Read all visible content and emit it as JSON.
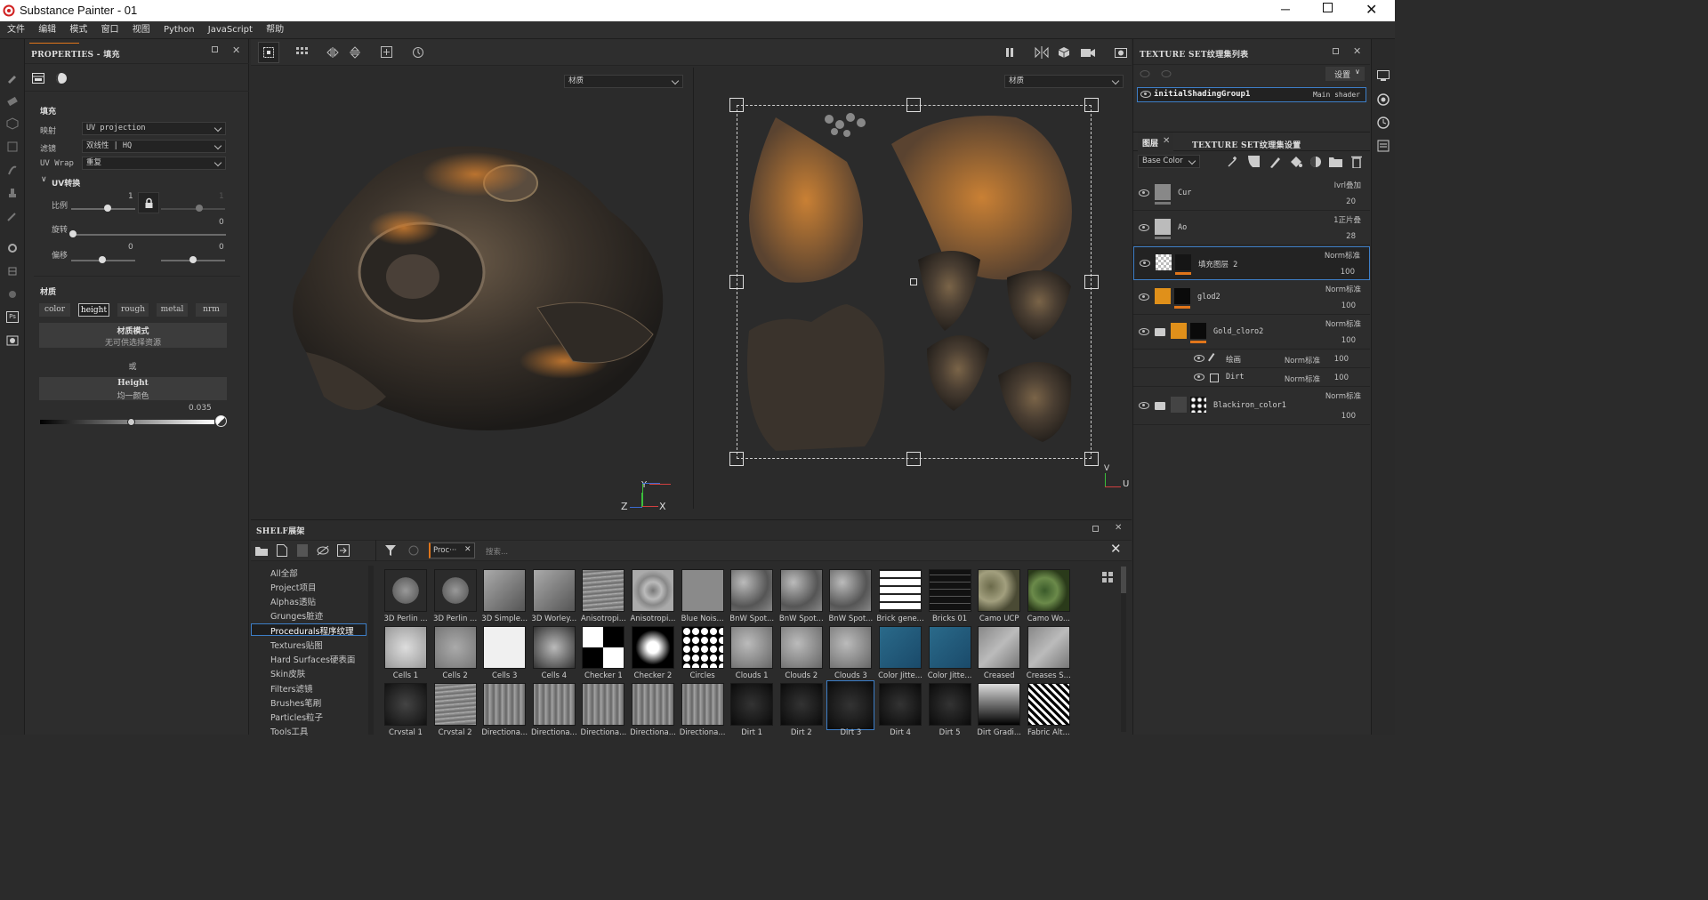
{
  "window": {
    "title": "Substance Painter - 01"
  },
  "menubar": [
    "文件",
    "编辑",
    "模式",
    "窗口",
    "视图",
    "Python",
    "JavaScript",
    "帮助"
  ],
  "properties": {
    "title": "PROPERTIES - 填充",
    "section_fill": "填充",
    "projection_label": "映射",
    "projection_value": "UV projection",
    "filter_label": "滤镜",
    "filter_value": "双线性 | HQ",
    "uvwrap_label": "UV Wrap",
    "uvwrap_value": "重复",
    "uv_transform_label": "UV转换",
    "scale_label": "比例",
    "scale_value": "1",
    "scale_value2": "1",
    "rotate_label": "旋转",
    "rotate_value": "0",
    "offset_label": "偏移",
    "offset_value1": "0",
    "offset_value2": "0",
    "material_label": "材质",
    "channels": [
      "color",
      "height",
      "rough",
      "metal",
      "nrm"
    ],
    "selected_channel": "height",
    "mat_mode_title": "材质模式",
    "mat_mode_sub": "无可供选择资源",
    "or_label": "或",
    "height_title": "Height",
    "height_sub": "均一颜色",
    "height_value": "0.035",
    "height_fraction": 0.52
  },
  "viewport": {
    "left_dropdown": "材质",
    "right_dropdown": "材质",
    "axis_left": {
      "z": "Z",
      "y": "Y",
      "x": "X"
    },
    "axis_right": {
      "v": "V",
      "u": "U"
    }
  },
  "shelf": {
    "title": "SHELF展架",
    "filter_tag": "Proc···",
    "search_placeholder": "搜索...",
    "categories": [
      "All全部",
      "Project项目",
      "Alphas透贴",
      "Grunges脏迹",
      "Procedurals程序纹理",
      "Textures贴图",
      "Hard Surfaces硬表面",
      "Skin皮肤",
      "Filters滤镜",
      "Brushes笔刷",
      "Particles粒子",
      "Tools工具"
    ],
    "selected_category": "Procedurals程序纹理",
    "row1": [
      "3D Perlin ...",
      "3D Perlin ...",
      "3D Simple...",
      "3D Worley...",
      "Anisotropi...",
      "Anisotropi...",
      "Blue Nois...",
      "BnW Spot...",
      "BnW Spot...",
      "BnW Spot...",
      "Brick gene...",
      "Bricks 01",
      "Camo UCP",
      "Camo Wo..."
    ],
    "row2": [
      "Cells 1",
      "Cells 2",
      "Cells 3",
      "Cells 4",
      "Checker 1",
      "Checker 2",
      "Circles",
      "Clouds 1",
      "Clouds 2",
      "Clouds 3",
      "Color Jitte...",
      "Color Jitte...",
      "Creased",
      "Creases S..."
    ],
    "row3": [
      "Crystal 1",
      "Crystal 2",
      "Directiona...",
      "Directiona...",
      "Directiona...",
      "Directiona...",
      "Directiona...",
      "Dirt 1",
      "Dirt 2",
      "Dirt 3",
      "Dirt 4",
      "Dirt 5",
      "Dirt Gradi...",
      "Fabric Alt..."
    ]
  },
  "texture_sets": {
    "title": "TEXTURE SET纹理集列表",
    "settings_btn": "设置",
    "set_name": "initialShadingGroup1",
    "set_shader": "Main shader"
  },
  "layers": {
    "tab_layers": "图层",
    "tab_settings": "TEXTURE SET纹理集设置",
    "channel_dropdown": "Base Color",
    "items": [
      {
        "name": "Cur",
        "blend": "Ivrl叠加",
        "opacity": "20"
      },
      {
        "name": "Ao",
        "blend": "1正片叠",
        "opacity": "28"
      },
      {
        "name": "填充图层 2",
        "blend": "Norm标准",
        "opacity": "100"
      },
      {
        "name": "glod2",
        "blend": "Norm标准",
        "opacity": "100"
      },
      {
        "name": "Gold_cloro2",
        "blend": "Norm标准",
        "opacity": "100"
      },
      {
        "name": "绘画",
        "blend": "Norm标准",
        "opacity": "100"
      },
      {
        "name": "Dirt",
        "blend": "Norm标准",
        "opacity": "100"
      },
      {
        "name": "Blackiron_color1",
        "blend": "Norm标准",
        "opacity": "100"
      }
    ]
  },
  "colors": {
    "accent_orange": "#e0751a",
    "selection_blue": "#3d7ec7",
    "ps_icon": "#cfcfcf"
  }
}
